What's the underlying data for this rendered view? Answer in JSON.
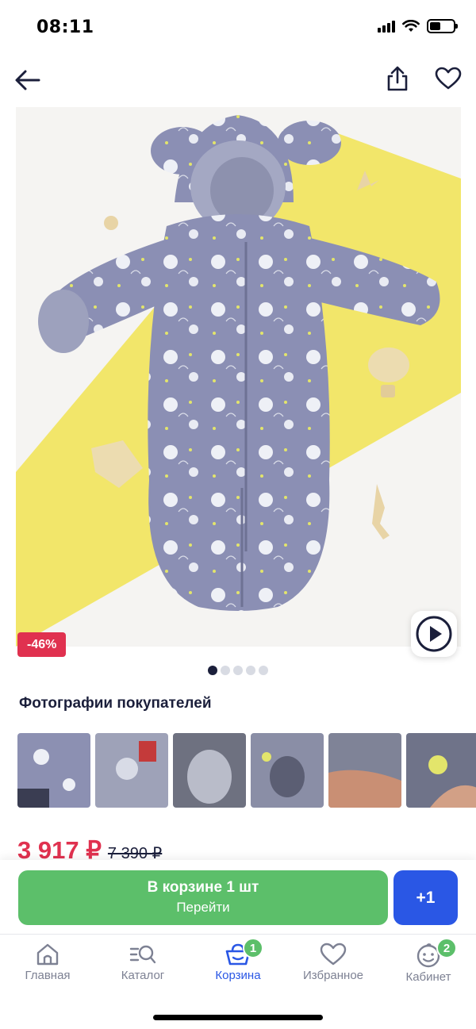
{
  "status_bar": {
    "time": "08:11"
  },
  "product": {
    "discount_badge": "-46%",
    "photo_pages": 5,
    "active_page": 1
  },
  "customer_photos": {
    "title": "Фотографии покупателей",
    "count": 6
  },
  "price": {
    "current": "3 917 ₽",
    "old": "7 390 ₽"
  },
  "cart_button": {
    "line1": "В корзине 1 шт",
    "line2": "Перейти"
  },
  "plus_button": {
    "label": "+1"
  },
  "tab_bar": {
    "items": [
      {
        "label": "Главная",
        "icon": "home-icon"
      },
      {
        "label": "Каталог",
        "icon": "catalog-icon"
      },
      {
        "label": "Корзина",
        "icon": "basket-icon",
        "badge": "1"
      },
      {
        "label": "Избранное",
        "icon": "heart-icon"
      },
      {
        "label": "Кабинет",
        "icon": "profile-icon",
        "badge": "2"
      }
    ],
    "active_index": 2
  },
  "colors": {
    "accent_blue": "#2a57e5",
    "green": "#5cbf6a",
    "sale_red": "#e0314f",
    "text_dark": "#1b1f3b"
  }
}
